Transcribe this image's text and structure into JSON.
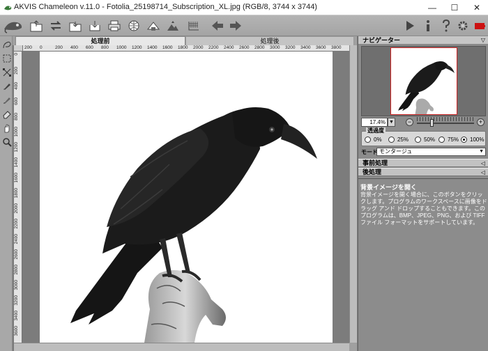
{
  "window": {
    "title": "AKVIS Chameleon v.11.0 - Fotolia_25198714_Subscription_XL.jpg (RGB/8, 3744 x 3744)",
    "minimize": "—",
    "maximize": "☐",
    "close": "✕"
  },
  "toolbar": {
    "items": [
      "chameleon-logo",
      "open-image",
      "collage",
      "save",
      "export",
      "print",
      "share",
      "camera",
      "mountain",
      "stamp",
      "flip",
      "undo",
      "redo"
    ],
    "right_items": [
      "run",
      "info",
      "help",
      "settings",
      "alert"
    ]
  },
  "tools": [
    "quick-selection",
    "rect-selection",
    "transform",
    "brush",
    "pencil",
    "eraser",
    "hand",
    "zoom"
  ],
  "tabs": {
    "before": "処理前",
    "after": "処理後"
  },
  "ruler": {
    "h_ticks": [
      "200",
      "0",
      "200",
      "400",
      "600",
      "800",
      "1000",
      "1200",
      "1400",
      "1600",
      "1800",
      "2000",
      "2200",
      "2400",
      "2600",
      "2800",
      "3000",
      "3200",
      "3400",
      "3600",
      "3800"
    ],
    "v_ticks": [
      "0",
      "200",
      "400",
      "600",
      "800",
      "1000",
      "1200",
      "1400",
      "1600",
      "1800",
      "2000",
      "2200",
      "2400",
      "2600",
      "2800",
      "3000",
      "3200",
      "3400",
      "3600"
    ]
  },
  "navigator": {
    "title": "ナビゲーター",
    "zoom_value": "17.4%",
    "zoom_minus": "−",
    "zoom_plus": "+"
  },
  "transparency": {
    "label": "透過度",
    "options": [
      "0%",
      "25%",
      "50%",
      "75%",
      "100%"
    ],
    "selected": "100%"
  },
  "mode": {
    "label": "モード",
    "value": "モンタージュ"
  },
  "sections": {
    "pre": "事前処理",
    "post": "後処理"
  },
  "help": {
    "title": "背景イメージを開く",
    "text": "背景イメージを開く場合に、このボタンをクリックします。プログラムのワークスペースに画像をドラッグ アンド ドロップすることもできます。このプログラムは、BMP、JPEG、PNG、および TIFF ファイル フォーマットをサポートしています。"
  }
}
